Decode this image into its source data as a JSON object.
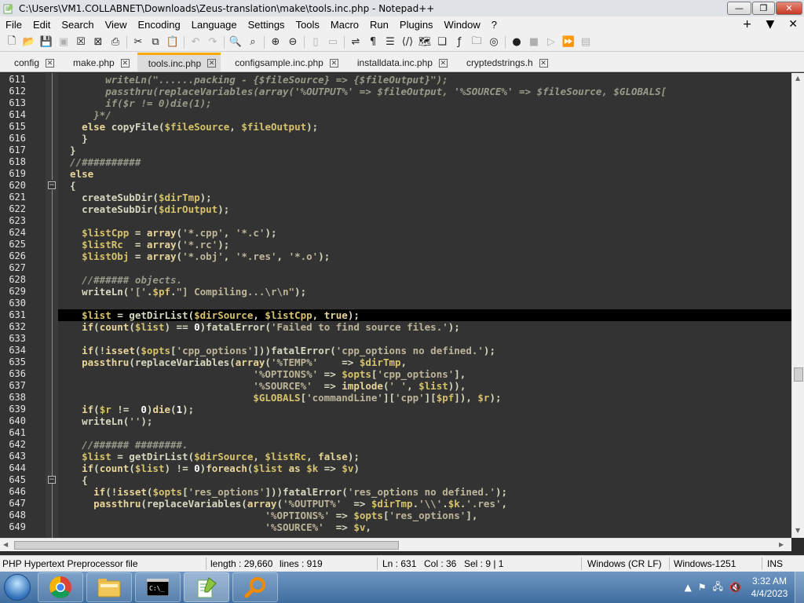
{
  "window": {
    "title": "C:\\Users\\VM1.COLLABNET\\Downloads\\Zeus-translation\\make\\tools.inc.php - Notepad++"
  },
  "menu": [
    "File",
    "Edit",
    "Search",
    "View",
    "Encoding",
    "Language",
    "Settings",
    "Tools",
    "Macro",
    "Run",
    "Plugins",
    "Window",
    "?"
  ],
  "menu_right": [
    "+",
    "▼",
    "✕"
  ],
  "tabs": [
    {
      "label": "config",
      "active": false
    },
    {
      "label": "make.php",
      "active": false
    },
    {
      "label": "tools.inc.php",
      "active": true
    },
    {
      "label": "configsample.inc.php",
      "active": false
    },
    {
      "label": "installdata.inc.php",
      "active": false
    },
    {
      "label": "cryptedstrings.h",
      "active": false
    }
  ],
  "code": {
    "first_line": 611,
    "current_line": 631,
    "lines": [
      [
        [
          "cm",
          "        writeLn(\"......packing - {$fileSource} => {$fileOutput}\");"
        ]
      ],
      [
        [
          "cm",
          "        passthru(replaceVariables(array('%OUTPUT%' => $fileOutput, '%SOURCE%' => $fileSource, $GLOBALS["
        ]
      ],
      [
        [
          "cm",
          "        if($r != 0)die(1);"
        ]
      ],
      [
        [
          "cm",
          "      }*/"
        ]
      ],
      [
        [
          "plain",
          "    "
        ],
        [
          "kw",
          "else"
        ],
        [
          "plain",
          " copyFile("
        ],
        [
          "var",
          "$fileSource"
        ],
        [
          "plain",
          ", "
        ],
        [
          "var",
          "$fileOutput"
        ],
        [
          "plain",
          ");"
        ]
      ],
      [
        [
          "plain",
          "    }"
        ]
      ],
      [
        [
          "plain",
          "  }"
        ]
      ],
      [
        [
          "cm",
          "  //##########"
        ]
      ],
      [
        [
          "kw",
          "  else"
        ]
      ],
      [
        [
          "plain",
          "  {"
        ]
      ],
      [
        [
          "plain",
          "    createSubDir("
        ],
        [
          "var",
          "$dirTmp"
        ],
        [
          "plain",
          ");"
        ]
      ],
      [
        [
          "plain",
          "    createSubDir("
        ],
        [
          "var",
          "$dirOutput"
        ],
        [
          "plain",
          ");"
        ]
      ],
      [
        [
          "plain",
          ""
        ]
      ],
      [
        [
          "var",
          "    $listCpp"
        ],
        [
          "plain",
          " = "
        ],
        [
          "kw",
          "array"
        ],
        [
          "plain",
          "("
        ],
        [
          "str",
          "'*.cpp'"
        ],
        [
          "plain",
          ", "
        ],
        [
          "str",
          "'*.c'"
        ],
        [
          "plain",
          ");"
        ]
      ],
      [
        [
          "var",
          "    $listRc"
        ],
        [
          "plain",
          "  = "
        ],
        [
          "kw",
          "array"
        ],
        [
          "plain",
          "("
        ],
        [
          "str",
          "'*.rc'"
        ],
        [
          "plain",
          ");"
        ]
      ],
      [
        [
          "var",
          "    $listObj"
        ],
        [
          "plain",
          " = "
        ],
        [
          "kw",
          "array"
        ],
        [
          "plain",
          "("
        ],
        [
          "str",
          "'*.obj'"
        ],
        [
          "plain",
          ", "
        ],
        [
          "str",
          "'*.res'"
        ],
        [
          "plain",
          ", "
        ],
        [
          "str",
          "'*.o'"
        ],
        [
          "plain",
          ");"
        ]
      ],
      [
        [
          "plain",
          ""
        ]
      ],
      [
        [
          "cm",
          "    //###### objects."
        ]
      ],
      [
        [
          "plain",
          "    writeLn("
        ],
        [
          "str",
          "'['"
        ],
        [
          "plain",
          "."
        ],
        [
          "var",
          "$pf"
        ],
        [
          "plain",
          "."
        ],
        [
          "str",
          "\"] Compiling...\\r\\n\""
        ],
        [
          "plain",
          ");"
        ]
      ],
      [
        [
          "plain",
          ""
        ]
      ],
      [
        [
          "var",
          "    $list"
        ],
        [
          "plain",
          " = getDirList("
        ],
        [
          "var",
          "$dirSource"
        ],
        [
          "plain",
          ", "
        ],
        [
          "var",
          "$listCpp"
        ],
        [
          "plain",
          ", "
        ],
        [
          "kw",
          "true"
        ],
        [
          "plain",
          ");"
        ]
      ],
      [
        [
          "kw",
          "    if"
        ],
        [
          "plain",
          "("
        ],
        [
          "kw",
          "count"
        ],
        [
          "plain",
          "("
        ],
        [
          "var",
          "$list"
        ],
        [
          "plain",
          ") == "
        ],
        [
          "num",
          "0"
        ],
        [
          "plain",
          ")fatalError("
        ],
        [
          "str",
          "'Failed to find source files.'"
        ],
        [
          "plain",
          ");"
        ]
      ],
      [
        [
          "plain",
          ""
        ]
      ],
      [
        [
          "kw",
          "    if"
        ],
        [
          "plain",
          "(!"
        ],
        [
          "kw",
          "isset"
        ],
        [
          "plain",
          "("
        ],
        [
          "var",
          "$opts"
        ],
        [
          "plain",
          "["
        ],
        [
          "str",
          "'cpp_options'"
        ],
        [
          "plain",
          "]))fatalError("
        ],
        [
          "str",
          "'cpp_options no defined.'"
        ],
        [
          "plain",
          ");"
        ]
      ],
      [
        [
          "kw",
          "    passthru"
        ],
        [
          "plain",
          "(replaceVariables("
        ],
        [
          "kw",
          "array"
        ],
        [
          "plain",
          "("
        ],
        [
          "str",
          "'%TEMP%'"
        ],
        [
          "plain",
          "    => "
        ],
        [
          "var",
          "$dirTmp"
        ],
        [
          "plain",
          ","
        ]
      ],
      [
        [
          "plain",
          "                                 "
        ],
        [
          "str",
          "'%OPTIONS%'"
        ],
        [
          "plain",
          " => "
        ],
        [
          "var",
          "$opts"
        ],
        [
          "plain",
          "["
        ],
        [
          "str",
          "'cpp_options'"
        ],
        [
          "plain",
          "],"
        ]
      ],
      [
        [
          "plain",
          "                                 "
        ],
        [
          "str",
          "'%SOURCE%'"
        ],
        [
          "plain",
          "  => "
        ],
        [
          "kw",
          "implode"
        ],
        [
          "plain",
          "("
        ],
        [
          "str",
          "' '"
        ],
        [
          "plain",
          ", "
        ],
        [
          "var",
          "$list"
        ],
        [
          "plain",
          ")),"
        ]
      ],
      [
        [
          "plain",
          "                                 "
        ],
        [
          "var",
          "$GLOBALS"
        ],
        [
          "plain",
          "["
        ],
        [
          "str",
          "'commandLine'"
        ],
        [
          "plain",
          "]["
        ],
        [
          "str",
          "'cpp'"
        ],
        [
          "plain",
          "]["
        ],
        [
          "var",
          "$pf"
        ],
        [
          "plain",
          "]), "
        ],
        [
          "var",
          "$r"
        ],
        [
          "plain",
          ");"
        ]
      ],
      [
        [
          "kw",
          "    if"
        ],
        [
          "plain",
          "("
        ],
        [
          "var",
          "$r"
        ],
        [
          "plain",
          " !=  "
        ],
        [
          "num",
          "0"
        ],
        [
          "plain",
          ")"
        ],
        [
          "kw",
          "die"
        ],
        [
          "plain",
          "("
        ],
        [
          "num",
          "1"
        ],
        [
          "plain",
          ");"
        ]
      ],
      [
        [
          "plain",
          "    writeLn("
        ],
        [
          "str",
          "''"
        ],
        [
          "plain",
          ");"
        ]
      ],
      [
        [
          "plain",
          ""
        ]
      ],
      [
        [
          "cm",
          "    //###### ########."
        ]
      ],
      [
        [
          "var",
          "    $list"
        ],
        [
          "plain",
          " = getDirList("
        ],
        [
          "var",
          "$dirSource"
        ],
        [
          "plain",
          ", "
        ],
        [
          "var",
          "$listRc"
        ],
        [
          "plain",
          ", "
        ],
        [
          "kw",
          "false"
        ],
        [
          "plain",
          ");"
        ]
      ],
      [
        [
          "kw",
          "    if"
        ],
        [
          "plain",
          "("
        ],
        [
          "kw",
          "count"
        ],
        [
          "plain",
          "("
        ],
        [
          "var",
          "$list"
        ],
        [
          "plain",
          ") != "
        ],
        [
          "num",
          "0"
        ],
        [
          "plain",
          ")"
        ],
        [
          "kw",
          "foreach"
        ],
        [
          "plain",
          "("
        ],
        [
          "var",
          "$list"
        ],
        [
          "plain",
          " "
        ],
        [
          "kw",
          "as"
        ],
        [
          "plain",
          " "
        ],
        [
          "var",
          "$k"
        ],
        [
          "plain",
          " => "
        ],
        [
          "var",
          "$v"
        ],
        [
          "plain",
          ")"
        ]
      ],
      [
        [
          "plain",
          "    {"
        ]
      ],
      [
        [
          "kw",
          "      if"
        ],
        [
          "plain",
          "(!"
        ],
        [
          "kw",
          "isset"
        ],
        [
          "plain",
          "("
        ],
        [
          "var",
          "$opts"
        ],
        [
          "plain",
          "["
        ],
        [
          "str",
          "'res_options'"
        ],
        [
          "plain",
          "]))fatalError("
        ],
        [
          "str",
          "'res_options no defined.'"
        ],
        [
          "plain",
          ");"
        ]
      ],
      [
        [
          "kw",
          "      passthru"
        ],
        [
          "plain",
          "(replaceVariables("
        ],
        [
          "kw",
          "array"
        ],
        [
          "plain",
          "("
        ],
        [
          "str",
          "'%OUTPUT%'"
        ],
        [
          "plain",
          "  => "
        ],
        [
          "var",
          "$dirTmp"
        ],
        [
          "plain",
          "."
        ],
        [
          "str",
          "'\\\\'"
        ],
        [
          "plain",
          "."
        ],
        [
          "var",
          "$k"
        ],
        [
          "plain",
          "."
        ],
        [
          "str",
          "'.res'"
        ],
        [
          "plain",
          ","
        ]
      ],
      [
        [
          "plain",
          "                                   "
        ],
        [
          "str",
          "'%OPTIONS%'"
        ],
        [
          "plain",
          " => "
        ],
        [
          "var",
          "$opts"
        ],
        [
          "plain",
          "["
        ],
        [
          "str",
          "'res_options'"
        ],
        [
          "plain",
          "],"
        ]
      ],
      [
        [
          "plain",
          "                                   "
        ],
        [
          "str",
          "'%SOURCE%'"
        ],
        [
          "plain",
          "  => "
        ],
        [
          "var",
          "$v"
        ],
        [
          "plain",
          ","
        ]
      ]
    ]
  },
  "status": {
    "file_type": "PHP Hypertext Preprocessor file",
    "length": "length : 29,660",
    "lines": "lines : 919",
    "ln": "Ln : 631",
    "col": "Col : 36",
    "sel": "Sel : 9 | 1",
    "eol": "Windows (CR LF)",
    "encoding": "Windows-1251",
    "mode": "INS"
  },
  "taskbar": {
    "time": "3:32 AM",
    "date": "4/4/2023"
  },
  "icons": {
    "app": "notepadpp-icon",
    "start": "windows-start-icon",
    "chrome": "chrome-icon",
    "explorer": "folder-icon",
    "cmd": "cmd-icon",
    "npp": "notepadpp-icon",
    "search": "search-magnifier-icon"
  }
}
